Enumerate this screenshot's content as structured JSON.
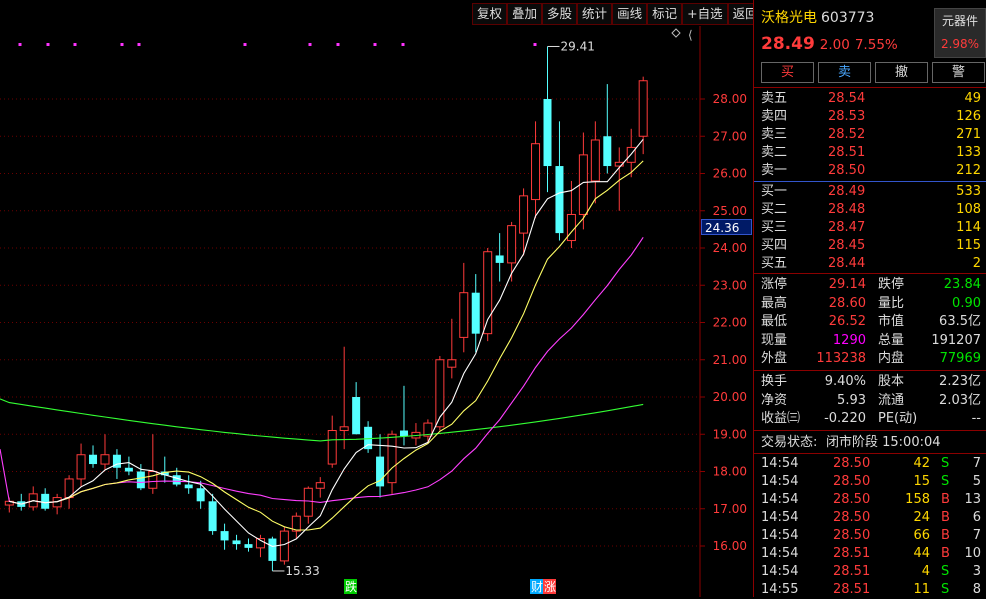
{
  "toolbar": {
    "items": [
      "复权",
      "叠加",
      "多股",
      "统计",
      "画线",
      "标记",
      "+自选",
      "返回"
    ]
  },
  "stock": {
    "name": "沃格光电",
    "code": "603773",
    "price": "28.49",
    "change": "2.00",
    "change_pct": "7.55%",
    "sector": "元器件",
    "sector_pct": "2.98%"
  },
  "actions": {
    "buy": "买",
    "sell": "卖",
    "cancel": "撤",
    "alert": "警"
  },
  "asks": [
    {
      "label": "卖五",
      "price": "28.54",
      "vol": "49"
    },
    {
      "label": "卖四",
      "price": "28.53",
      "vol": "126"
    },
    {
      "label": "卖三",
      "price": "28.52",
      "vol": "271"
    },
    {
      "label": "卖二",
      "price": "28.51",
      "vol": "133"
    },
    {
      "label": "卖一",
      "price": "28.50",
      "vol": "212"
    }
  ],
  "bids": [
    {
      "label": "买一",
      "price": "28.49",
      "vol": "533"
    },
    {
      "label": "买二",
      "price": "28.48",
      "vol": "108"
    },
    {
      "label": "买三",
      "price": "28.47",
      "vol": "114"
    },
    {
      "label": "买四",
      "price": "28.45",
      "vol": "115"
    },
    {
      "label": "买五",
      "price": "28.44",
      "vol": "2"
    }
  ],
  "stats": {
    "limit_up_label": "涨停",
    "limit_up": "29.14",
    "limit_down_label": "跌停",
    "limit_down": "23.84",
    "high_label": "最高",
    "high": "28.60",
    "vol_ratio_label": "量比",
    "vol_ratio": "0.90",
    "low_label": "最低",
    "low": "26.52",
    "mkt_cap_label": "市值",
    "mkt_cap": "63.5亿",
    "cur_vol_label": "现量",
    "cur_vol": "1290",
    "total_vol_label": "总量",
    "total_vol": "191207",
    "outer_label": "外盘",
    "outer": "113238",
    "inner_label": "内盘",
    "inner": "77969",
    "turnover_label": "换手",
    "turnover": "9.40%",
    "shares_label": "股本",
    "shares": "2.23亿",
    "nav_label": "净资",
    "nav": "5.93",
    "float_label": "流通",
    "float": "2.03亿",
    "eps_label": "收益㈢",
    "eps": "-0.220",
    "pe_label": "PE(动)",
    "pe": "--"
  },
  "trade_status": {
    "label": "交易状态:",
    "value": "闭市阶段 15:00:04"
  },
  "ticks": [
    {
      "time": "14:54",
      "price": "28.50",
      "vol": "42",
      "side": "S",
      "count": "7"
    },
    {
      "time": "14:54",
      "price": "28.50",
      "vol": "15",
      "side": "S",
      "count": "5"
    },
    {
      "time": "14:54",
      "price": "28.50",
      "vol": "158",
      "side": "B",
      "count": "13"
    },
    {
      "time": "14:54",
      "price": "28.50",
      "vol": "24",
      "side": "B",
      "count": "6"
    },
    {
      "time": "14:54",
      "price": "28.50",
      "vol": "66",
      "side": "B",
      "count": "7"
    },
    {
      "time": "14:54",
      "price": "28.51",
      "vol": "44",
      "side": "B",
      "count": "10"
    },
    {
      "time": "14:54",
      "price": "28.51",
      "vol": "4",
      "side": "S",
      "count": "3"
    },
    {
      "time": "14:55",
      "price": "28.51",
      "vol": "11",
      "side": "S",
      "count": "8"
    }
  ],
  "chart_data": {
    "type": "candlestick",
    "y_ticks": [
      "28.00",
      "27.00",
      "26.00",
      "25.00",
      "24.00",
      "23.00",
      "22.00",
      "21.00",
      "20.00",
      "19.00",
      "18.00",
      "17.00",
      "16.00"
    ],
    "ylim": [
      15.2,
      29.6
    ],
    "cursor_price": "24.36",
    "high_marker": "29.41",
    "low_marker": "15.33",
    "event_labels": [
      "跌",
      "财",
      "涨"
    ],
    "colors": {
      "up": "#ff3b3b",
      "down": "#54ffff",
      "ma5": "#ffffff",
      "ma10": "#ffff66",
      "ma20": "#ff3fff",
      "ma60": "#33ff33"
    },
    "candles": [
      [
        17.1,
        17.3,
        16.9,
        17.2
      ],
      [
        17.2,
        17.4,
        16.95,
        17.05
      ],
      [
        17.05,
        17.6,
        16.95,
        17.4
      ],
      [
        17.4,
        17.55,
        16.95,
        17.0
      ],
      [
        17.05,
        17.4,
        16.85,
        17.3
      ],
      [
        17.3,
        17.9,
        17.0,
        17.8
      ],
      [
        17.8,
        18.75,
        17.6,
        18.45
      ],
      [
        18.45,
        18.7,
        18.1,
        18.2
      ],
      [
        18.2,
        19.0,
        18.05,
        18.45
      ],
      [
        18.45,
        18.6,
        17.8,
        18.1
      ],
      [
        18.1,
        18.4,
        17.9,
        18.0
      ],
      [
        18.0,
        18.2,
        17.5,
        17.55
      ],
      [
        17.55,
        19.0,
        17.4,
        18.0
      ],
      [
        18.0,
        18.4,
        17.7,
        17.9
      ],
      [
        17.9,
        18.1,
        17.6,
        17.65
      ],
      [
        17.65,
        17.9,
        17.4,
        17.55
      ],
      [
        17.55,
        17.75,
        17.0,
        17.2
      ],
      [
        17.2,
        17.4,
        16.3,
        16.4
      ],
      [
        16.4,
        16.6,
        15.9,
        16.15
      ],
      [
        16.15,
        16.3,
        15.9,
        16.05
      ],
      [
        16.05,
        16.2,
        15.85,
        15.95
      ],
      [
        15.95,
        16.3,
        15.7,
        16.2
      ],
      [
        16.2,
        16.25,
        15.33,
        15.6
      ],
      [
        15.6,
        16.5,
        15.5,
        16.4
      ],
      [
        16.4,
        16.9,
        16.2,
        16.8
      ],
      [
        16.8,
        17.6,
        16.6,
        17.55
      ],
      [
        17.55,
        17.85,
        17.3,
        17.7
      ],
      [
        18.2,
        19.5,
        18.1,
        19.1
      ],
      [
        19.1,
        21.35,
        18.6,
        19.2
      ],
      [
        20.0,
        20.4,
        19.0,
        19.0
      ],
      [
        19.2,
        19.35,
        18.5,
        18.6
      ],
      [
        18.4,
        19.0,
        17.3,
        17.6
      ],
      [
        17.7,
        19.1,
        17.4,
        19.0
      ],
      [
        19.1,
        20.3,
        18.7,
        18.95
      ],
      [
        18.9,
        19.3,
        18.7,
        19.05
      ],
      [
        18.95,
        19.4,
        18.8,
        19.3
      ],
      [
        19.2,
        21.1,
        19.1,
        21.0
      ],
      [
        20.8,
        22.1,
        20.5,
        21.0
      ],
      [
        21.6,
        23.6,
        21.2,
        22.8
      ],
      [
        22.8,
        23.3,
        21.2,
        21.7
      ],
      [
        21.7,
        24.0,
        21.5,
        23.9
      ],
      [
        23.8,
        24.4,
        23.1,
        23.6
      ],
      [
        23.6,
        24.7,
        23.1,
        24.6
      ],
      [
        24.4,
        25.6,
        23.8,
        25.4
      ],
      [
        25.3,
        27.4,
        24.8,
        26.8
      ],
      [
        28.0,
        29.41,
        25.5,
        26.2
      ],
      [
        26.2,
        27.4,
        24.2,
        24.4
      ],
      [
        24.2,
        25.8,
        24.0,
        24.9
      ],
      [
        24.9,
        27.1,
        24.5,
        26.5
      ],
      [
        25.8,
        27.4,
        25.2,
        26.9
      ],
      [
        27.0,
        28.4,
        26.0,
        26.2
      ],
      [
        26.2,
        26.7,
        25.0,
        26.3
      ],
      [
        26.3,
        27.2,
        25.9,
        26.7
      ],
      [
        27.0,
        28.6,
        26.52,
        28.49
      ]
    ]
  }
}
